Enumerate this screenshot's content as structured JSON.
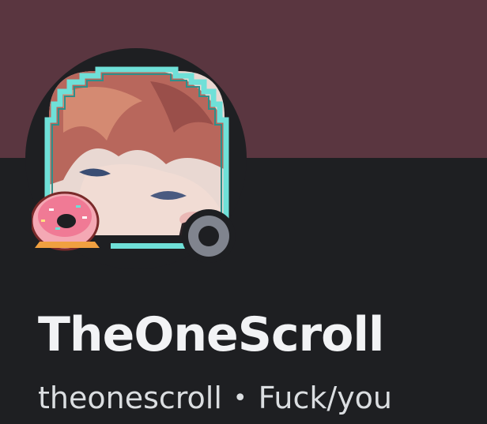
{
  "profile": {
    "display_name": "TheOneScroll",
    "username": "theonescroll",
    "separator": "•",
    "pronouns": "Fuck/you",
    "status": "offline"
  },
  "colors": {
    "banner": "#5a3640",
    "background": "#1e1f22",
    "avatar_frame": "#6fe0d8",
    "status_offline": "#80848e",
    "name_text": "#f2f3f5",
    "sub_text": "#dbdee1"
  },
  "icons": {
    "avatar": "anime-avatar-image",
    "avatar_decoration": "pixel-frame-with-donut",
    "status": "offline-status-icon"
  }
}
